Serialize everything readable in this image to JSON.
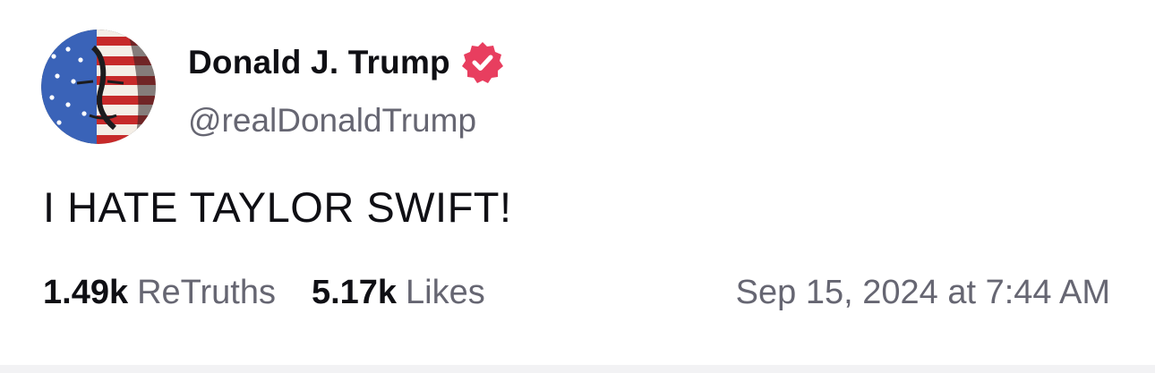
{
  "author": {
    "display_name": "Donald J. Trump",
    "handle": "@realDonaldTrump",
    "verified": true,
    "verified_icon": "verified-badge-icon",
    "avatar": "avatar-image"
  },
  "post": {
    "text": "I HATE TAYLOR SWIFT!"
  },
  "stats": {
    "retruths_count": "1.49k",
    "retruths_label": "ReTruths",
    "likes_count": "5.17k",
    "likes_label": "Likes"
  },
  "timestamp": "Sep 15, 2024 at 7:44 AM",
  "colors": {
    "badge": "#e83e5f",
    "text_primary": "#0f0f14",
    "text_secondary": "#666672"
  }
}
